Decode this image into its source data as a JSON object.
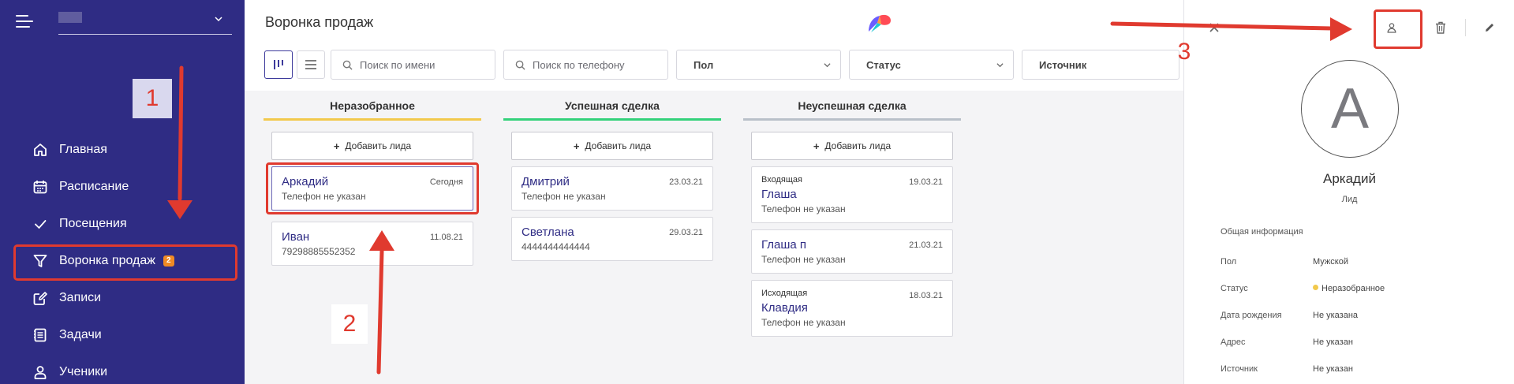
{
  "sidebar": {
    "nav": [
      {
        "label": "Главная",
        "icon": "home-icon"
      },
      {
        "label": "Расписание",
        "icon": "calendar-icon"
      },
      {
        "label": "Посещения",
        "icon": "checkmark-icon"
      },
      {
        "label": "Воронка продаж",
        "icon": "funnel-icon",
        "badge": "2",
        "active": true
      },
      {
        "label": "Записи",
        "icon": "edit-note-icon"
      },
      {
        "label": "Задачи",
        "icon": "task-list-icon"
      },
      {
        "label": "Ученики",
        "icon": "user-icon"
      }
    ]
  },
  "header": {
    "title": "Воронка продаж"
  },
  "filters": {
    "search_name_placeholder": "Поиск по имени",
    "search_phone_placeholder": "Поиск по телефону",
    "gender": "Пол",
    "status": "Статус",
    "source": "Источник"
  },
  "columns": [
    {
      "title": "Неразобранное",
      "color": "#f2c94c",
      "add_label": "Добавить лида",
      "cards": [
        {
          "name": "Аркадий",
          "date": "Сегодня",
          "sub": "Телефон не указан"
        },
        {
          "name": "Иван",
          "date": "11.08.21",
          "sub": "79298885552352"
        }
      ]
    },
    {
      "title": "Успешная сделка",
      "color": "#33d17a",
      "add_label": "Добавить лида",
      "cards": [
        {
          "name": "Дмитрий",
          "date": "23.03.21",
          "sub": "Телефон не указан"
        },
        {
          "name": "Светлана",
          "date": "29.03.21",
          "sub": "4444444444444"
        }
      ]
    },
    {
      "title": "Неуспешная сделка",
      "color": "#b9c0c9",
      "add_label": "Добавить лида",
      "cards": [
        {
          "tag": "Входящая",
          "name": "Глаша",
          "date": "19.03.21",
          "sub": "Телефон не указан"
        },
        {
          "name": "Глаша п",
          "date": "21.03.21",
          "sub": "Телефон не указан"
        },
        {
          "tag": "Исходящая",
          "name": "Клавдия",
          "date": "18.03.21",
          "sub": "Телефон не указан"
        }
      ]
    }
  ],
  "panel": {
    "avatar_letter": "А",
    "name": "Аркадий",
    "role": "Лид",
    "section": "Общая информация",
    "rows": [
      {
        "key": "Пол",
        "value": "Мужской"
      },
      {
        "key": "Статус",
        "value": "Неразобранное",
        "dot_color": "#f2c94c"
      },
      {
        "key": "Дата рождения",
        "value": "Не указана"
      },
      {
        "key": "Адрес",
        "value": "Не указан"
      },
      {
        "key": "Источник",
        "value": "Не указан"
      }
    ]
  },
  "annotations": {
    "n1": "1",
    "n2": "2",
    "n3": "3"
  },
  "colors": {
    "sidebar_bg": "#2f2c84",
    "accent": "#2f2c84",
    "annotation": "#e03a2f",
    "badge": "#f08a24"
  }
}
